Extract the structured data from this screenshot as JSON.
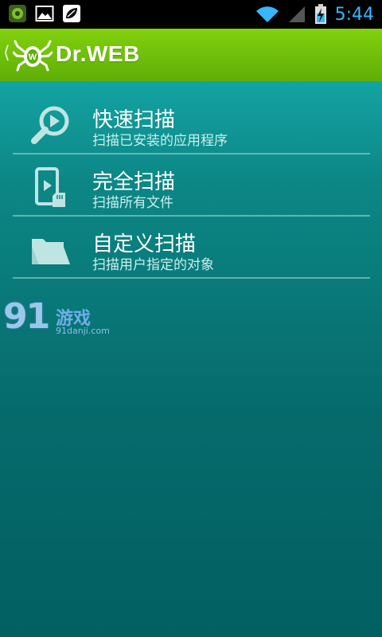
{
  "status_bar": {
    "time": "5:44",
    "icons": [
      "app-notification-icon",
      "image-notification-icon",
      "download-notification-icon",
      "wifi-icon",
      "signal-icon",
      "battery-charging-icon"
    ]
  },
  "action_bar": {
    "brand": "Dr.WEB",
    "accent": "#6cbf0a"
  },
  "menu": {
    "items": [
      {
        "title": "快速扫描",
        "subtitle": "扫描已安装的应用程序",
        "icon": "magnifier-play-icon"
      },
      {
        "title": "完全扫描",
        "subtitle": "扫描所有文件",
        "icon": "phone-sdcard-icon"
      },
      {
        "title": "自定义扫描",
        "subtitle": "扫描用户指定的对象",
        "icon": "folder-icon"
      }
    ]
  },
  "watermark": {
    "logo": "91",
    "name": "游戏",
    "url": "91danji.com"
  }
}
